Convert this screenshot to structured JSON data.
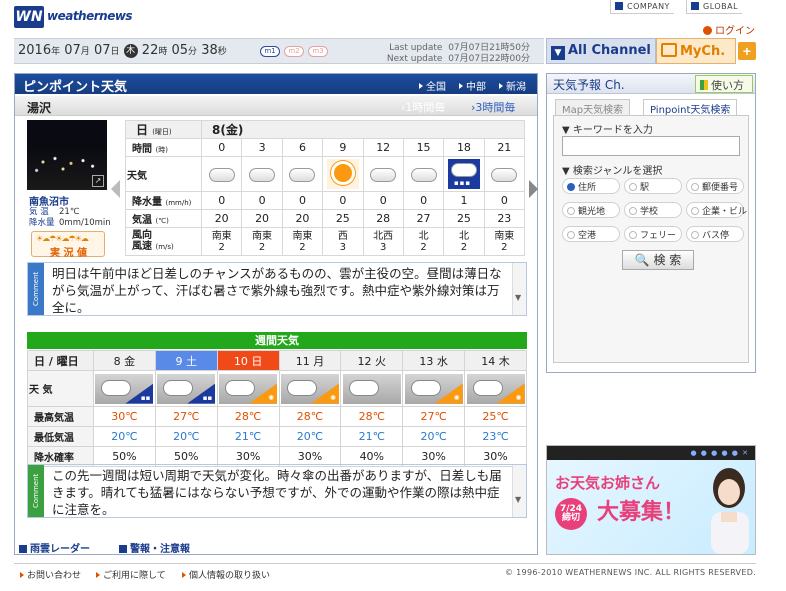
{
  "header": {
    "logo_mark": "WN",
    "logo_text": "weathernews",
    "company_link": "COMPANY",
    "global_link": "GLOBAL",
    "login": "ログイン"
  },
  "datebar": {
    "year": "2016",
    "year_unit": "年",
    "month": "07",
    "month_unit": "月",
    "day": "07",
    "day_unit": "日",
    "weekday": "木",
    "hour": "22",
    "hour_unit": "時",
    "minute": "05",
    "minute_unit": "分",
    "second": "38",
    "second_unit": "秒",
    "mode_buttons": [
      "m1",
      "m2",
      "m3"
    ],
    "last_update_label": "Last update",
    "last_update_value": "07月07日21時50分",
    "next_update_label": "Next update",
    "next_update_value": "07月07日22時00分"
  },
  "channels": {
    "all_channel": "All Channel",
    "my_ch": "MyCh.",
    "plus": "+"
  },
  "main": {
    "title": "ピンポイント天気",
    "regions": [
      "全国",
      "中部",
      "新潟"
    ],
    "city": "湯沢",
    "tab_1h": "1時間毎",
    "tab_3h": "3時間毎",
    "station": {
      "name": "南魚沼市",
      "temp_label": "気 温",
      "temp_value": "21℃",
      "precip_label": "降水量",
      "precip_value": "0mm/10min",
      "live_button": "実 況 値"
    }
  },
  "hourly": {
    "date": "8(金)",
    "labels": {
      "date": "日",
      "date_unit": "(曜日)",
      "time": "時間",
      "time_unit": "(時)",
      "weather": "天気",
      "precip": "降水量",
      "precip_unit": "(mm/h)",
      "temp": "気温",
      "temp_unit": "(℃)",
      "wind": "風向",
      "wind2": "風速",
      "wind_unit": "(m/s)"
    },
    "hours": [
      "0",
      "3",
      "6",
      "9",
      "12",
      "15",
      "18",
      "21"
    ],
    "weather": [
      "cloudy",
      "cloudy",
      "cloudy",
      "sunny",
      "cloudy",
      "cloudy",
      "rain",
      "cloudy"
    ],
    "precip": [
      "0",
      "0",
      "0",
      "0",
      "0",
      "0",
      "1",
      "0"
    ],
    "temp": [
      "20",
      "20",
      "20",
      "25",
      "28",
      "27",
      "25",
      "23"
    ],
    "wind_dir": [
      "南東",
      "南東",
      "南東",
      "西",
      "北西",
      "北",
      "北",
      "南東"
    ],
    "wind_speed": [
      "2",
      "2",
      "2",
      "3",
      "3",
      "2",
      "2",
      "2"
    ]
  },
  "comment1": {
    "tag": "Comment",
    "text": "明日は午前中ほど日差しのチャンスがあるものの、雲が主役の空。昼間は薄日ながら気温が上がって、汗ばむ暑さで紫外線も強烈です。熱中症や紫外線対策は万全に。"
  },
  "weekly": {
    "title": "週間天気",
    "labels": {
      "day": "日 / 曜日",
      "weather": "天 気",
      "high": "最高気温",
      "low": "最低気温",
      "pop": "降水確率"
    },
    "days": [
      {
        "date": "8",
        "wd": "金",
        "kind": "",
        "wx": "rain",
        "high": "30℃",
        "low": "20℃",
        "pop": "50%"
      },
      {
        "date": "9",
        "wd": "土",
        "kind": "sat",
        "wx": "rain",
        "high": "27℃",
        "low": "20℃",
        "pop": "50%"
      },
      {
        "date": "10",
        "wd": "日",
        "kind": "sun",
        "wx": "sun",
        "high": "28℃",
        "low": "21℃",
        "pop": "30%"
      },
      {
        "date": "11",
        "wd": "月",
        "kind": "",
        "wx": "sun",
        "high": "28℃",
        "low": "20℃",
        "pop": "30%"
      },
      {
        "date": "12",
        "wd": "火",
        "kind": "",
        "wx": "cloud",
        "high": "28℃",
        "low": "21℃",
        "pop": "40%"
      },
      {
        "date": "13",
        "wd": "水",
        "kind": "",
        "wx": "sun",
        "high": "27℃",
        "low": "20℃",
        "pop": "30%"
      },
      {
        "date": "14",
        "wd": "木",
        "kind": "",
        "wx": "sun",
        "high": "25℃",
        "low": "23℃",
        "pop": "30%"
      }
    ]
  },
  "comment2": {
    "tag": "Comment",
    "text": "この先一週間は短い周期で天気が変化。時々傘の出番がありますが、日差しも届きます。晴れても猛暑にはならない予想ですが、外での運動や作業の際は熱中症に注意を。"
  },
  "bottom_links": [
    "雨雲レーダー",
    "警報・注意報"
  ],
  "side": {
    "title": "天気予報 Ch.",
    "usage": "使い方",
    "tab_map": "Map天気検索",
    "tab_pinpoint": "Pinpoint天気検索",
    "keyword_label": "▼ キーワードを入力",
    "genre_label": "▼ 検索ジャンルを選択",
    "options": [
      "住所",
      "駅",
      "郵便番号",
      "観光地",
      "学校",
      "企業・ビル",
      "空港",
      "フェリー",
      "バス停"
    ],
    "selected": "住所",
    "search_button": "検 索"
  },
  "banner": {
    "line1": "お天気お姉さん",
    "line2": "大募集！",
    "badge_date": "7/24",
    "badge_text": "締切"
  },
  "footer": {
    "links": [
      "お問い合わせ",
      "ご利用に際して",
      "個人情報の取り扱い"
    ],
    "copyright": "© 1996-2010 WEATHERNEWS INC. ALL RIGHTS RESERVED."
  },
  "colors": {
    "brand": "#1a3c8c",
    "weekly_green": "#22a81a",
    "saturday": "#5a8ae8",
    "sunday": "#f04a18",
    "high_temp": "#e05000",
    "low_temp": "#2a7ad0"
  }
}
